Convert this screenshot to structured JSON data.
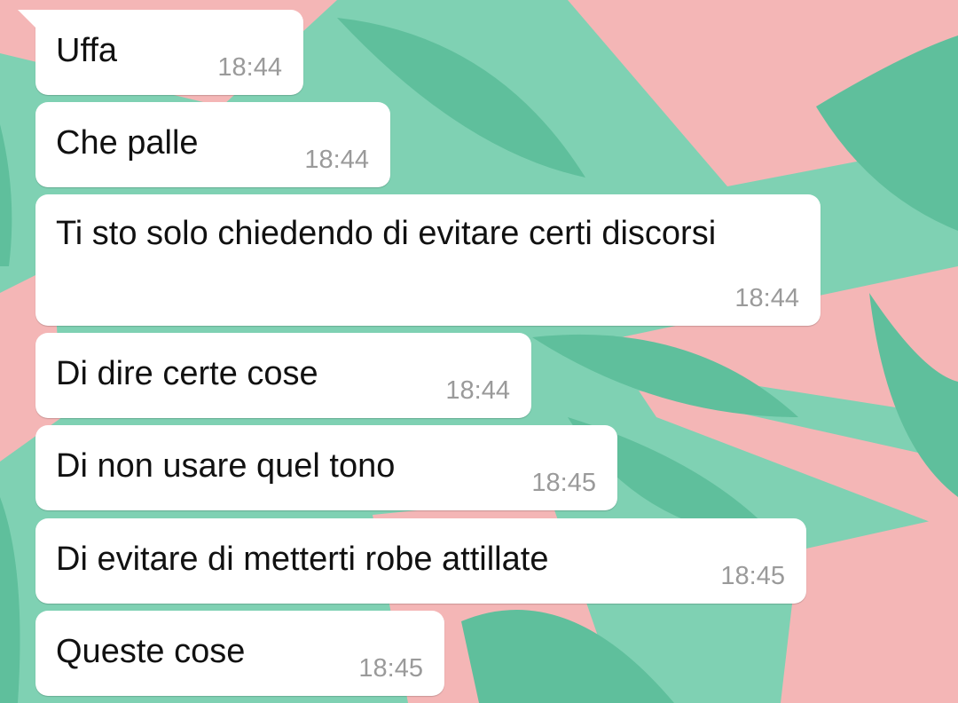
{
  "colors": {
    "wallpaper_base": "#7fd1b3",
    "wallpaper_leaf_dark": "#5fbf9c",
    "wallpaper_pink": "#f4b6b6",
    "bubble": "#ffffff",
    "text": "#111111",
    "timestamp": "#9a9a9a"
  },
  "messages": [
    {
      "text": "Uffa",
      "time": "18:44"
    },
    {
      "text": "Che palle",
      "time": "18:44"
    },
    {
      "text": "Ti sto solo chiedendo di evitare certi discorsi",
      "time": "18:44"
    },
    {
      "text": "Di dire certe cose",
      "time": "18:44"
    },
    {
      "text": "Di non usare quel tono",
      "time": "18:45"
    },
    {
      "text": "Di evitare di metterti robe attillate",
      "time": "18:45"
    },
    {
      "text": "Queste cose",
      "time": "18:45"
    }
  ]
}
